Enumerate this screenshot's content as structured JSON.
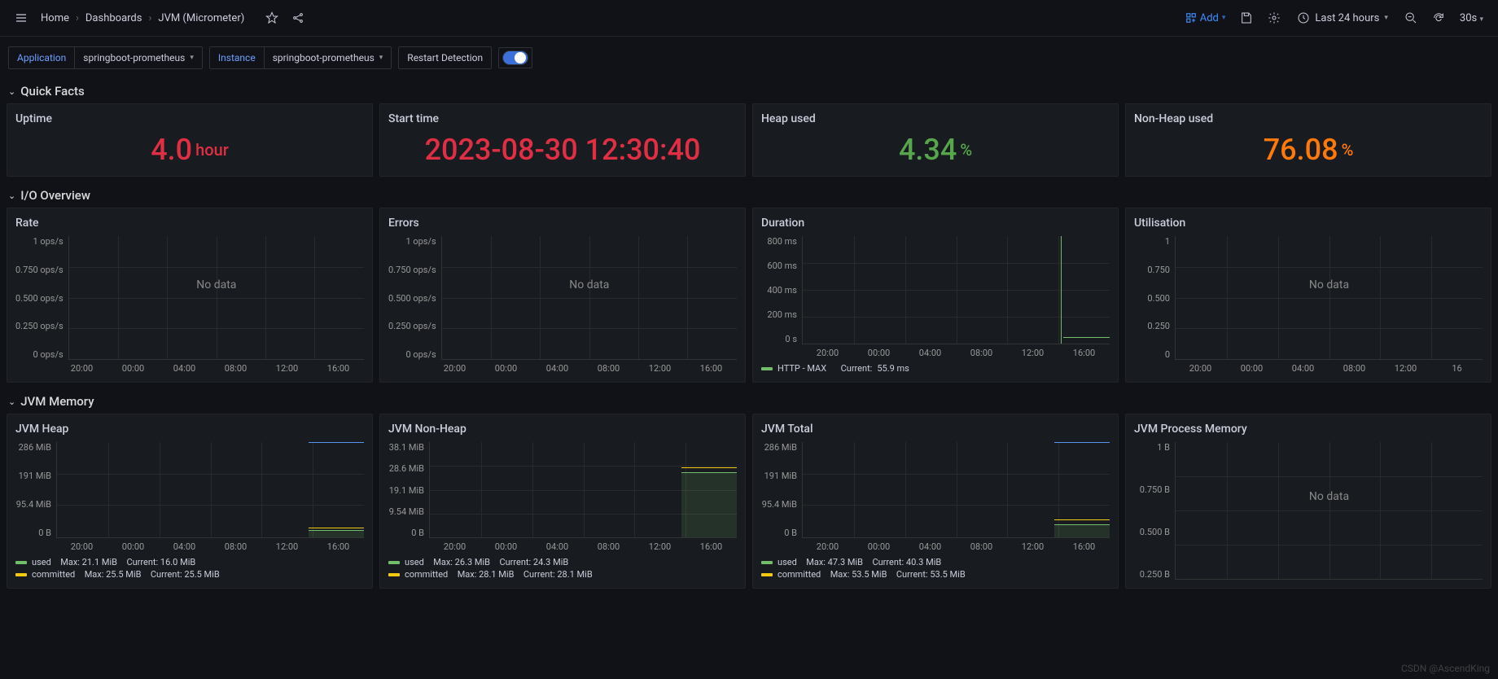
{
  "breadcrumb": {
    "home": "Home",
    "dashboards": "Dashboards",
    "current": "JVM (Micrometer)"
  },
  "header": {
    "add": "Add",
    "time_range": "Last 24 hours",
    "refresh_interval": "30s"
  },
  "vars": {
    "application_label": "Application",
    "application_value": "springboot-prometheus",
    "instance_label": "Instance",
    "instance_value": "springboot-prometheus",
    "restart_label": "Restart Detection"
  },
  "rows": {
    "quick_facts": "Quick Facts",
    "io_overview": "I/O Overview",
    "jvm_memory": "JVM Memory"
  },
  "stats": {
    "uptime": {
      "title": "Uptime",
      "value": "4.0",
      "unit": "hour"
    },
    "start_time": {
      "title": "Start time",
      "value": "2023-08-30 12:30:40"
    },
    "heap_used": {
      "title": "Heap used",
      "value": "4.34",
      "unit": "%"
    },
    "nonheap_used": {
      "title": "Non-Heap used",
      "value": "76.08",
      "unit": "%"
    }
  },
  "io": {
    "rate": {
      "title": "Rate",
      "y": [
        "1 ops/s",
        "0.750 ops/s",
        "0.500 ops/s",
        "0.250 ops/s",
        "0 ops/s"
      ],
      "nodata": "No data"
    },
    "errors": {
      "title": "Errors",
      "y": [
        "1 ops/s",
        "0.750 ops/s",
        "0.500 ops/s",
        "0.250 ops/s",
        "0 ops/s"
      ],
      "nodata": "No data"
    },
    "duration": {
      "title": "Duration",
      "y": [
        "800 ms",
        "600 ms",
        "400 ms",
        "200 ms",
        "0 s"
      ],
      "legend_series": "HTTP - MAX",
      "legend_current_label": "Current:",
      "legend_current_value": "55.9 ms"
    },
    "utilisation": {
      "title": "Utilisation",
      "y": [
        "1",
        "0.750",
        "0.500",
        "0.250",
        "0"
      ],
      "nodata": "No data"
    },
    "x_times": [
      "20:00",
      "00:00",
      "04:00",
      "08:00",
      "12:00",
      "16:00"
    ],
    "x_times_short": [
      "20:00",
      "00:00",
      "04:00",
      "08:00",
      "12:00",
      "16"
    ]
  },
  "mem": {
    "heap": {
      "title": "JVM Heap",
      "y": [
        "286 MiB",
        "191 MiB",
        "95.4 MiB",
        "0 B"
      ],
      "legend": [
        {
          "name": "used",
          "max": "Max: 21.1 MiB",
          "current": "Current: 16.0 MiB",
          "color": "sw-green"
        },
        {
          "name": "committed",
          "max": "Max: 25.5 MiB",
          "current": "Current: 25.5 MiB",
          "color": "sw-yellow"
        }
      ]
    },
    "nonheap": {
      "title": "JVM Non-Heap",
      "y": [
        "38.1 MiB",
        "28.6 MiB",
        "19.1 MiB",
        "9.54 MiB",
        "0 B"
      ],
      "legend": [
        {
          "name": "used",
          "max": "Max: 26.3 MiB",
          "current": "Current: 24.3 MiB",
          "color": "sw-green"
        },
        {
          "name": "committed",
          "max": "Max: 28.1 MiB",
          "current": "Current: 28.1 MiB",
          "color": "sw-yellow"
        }
      ]
    },
    "total": {
      "title": "JVM Total",
      "y": [
        "286 MiB",
        "191 MiB",
        "95.4 MiB",
        "0 B"
      ],
      "legend": [
        {
          "name": "used",
          "max": "Max: 47.3 MiB",
          "current": "Current: 40.3 MiB",
          "color": "sw-green"
        },
        {
          "name": "committed",
          "max": "Max: 53.5 MiB",
          "current": "Current: 53.5 MiB",
          "color": "sw-yellow"
        }
      ]
    },
    "process": {
      "title": "JVM Process Memory",
      "y": [
        "1 B",
        "0.750 B",
        "0.500 B",
        "0.250 B"
      ],
      "nodata": "No data"
    },
    "x_times": [
      "20:00",
      "00:00",
      "04:00",
      "08:00",
      "12:00",
      "16:00"
    ]
  },
  "watermark": "CSDN @AscendKing",
  "chart_data": [
    {
      "type": "stat",
      "title": "Uptime",
      "value": 4.0,
      "unit": "hour"
    },
    {
      "type": "stat",
      "title": "Start time",
      "value": "2023-08-30 12:30:40"
    },
    {
      "type": "stat",
      "title": "Heap used",
      "value": 4.34,
      "unit": "%"
    },
    {
      "type": "stat",
      "title": "Non-Heap used",
      "value": 76.08,
      "unit": "%"
    },
    {
      "type": "line",
      "title": "Rate",
      "ylabel": "ops/s",
      "ylim": [
        0,
        1
      ],
      "series": [],
      "x": [
        "20:00",
        "00:00",
        "04:00",
        "08:00",
        "12:00",
        "16:00"
      ]
    },
    {
      "type": "line",
      "title": "Errors",
      "ylabel": "ops/s",
      "ylim": [
        0,
        1
      ],
      "series": [],
      "x": [
        "20:00",
        "00:00",
        "04:00",
        "08:00",
        "12:00",
        "16:00"
      ]
    },
    {
      "type": "line",
      "title": "Duration",
      "ylabel": "ms",
      "ylim": [
        0,
        800
      ],
      "x": [
        "20:00",
        "00:00",
        "04:00",
        "08:00",
        "12:00",
        "16:00"
      ],
      "series": [
        {
          "name": "HTTP - MAX",
          "current": 55.9,
          "spike_at": "12:30",
          "spike_value": 800
        }
      ]
    },
    {
      "type": "line",
      "title": "Utilisation",
      "ylim": [
        0,
        1
      ],
      "series": [],
      "x": [
        "20:00",
        "00:00",
        "04:00",
        "08:00",
        "12:00",
        "16:00"
      ]
    },
    {
      "type": "area",
      "title": "JVM Heap",
      "ylabel": "MiB",
      "ylim": [
        0,
        286
      ],
      "x": [
        "20:00",
        "00:00",
        "04:00",
        "08:00",
        "12:00",
        "16:00"
      ],
      "series": [
        {
          "name": "used",
          "max": 21.1,
          "current": 16.0
        },
        {
          "name": "committed",
          "max": 25.5,
          "current": 25.5
        }
      ]
    },
    {
      "type": "area",
      "title": "JVM Non-Heap",
      "ylabel": "MiB",
      "ylim": [
        0,
        38.1
      ],
      "x": [
        "20:00",
        "00:00",
        "04:00",
        "08:00",
        "12:00",
        "16:00"
      ],
      "series": [
        {
          "name": "used",
          "max": 26.3,
          "current": 24.3
        },
        {
          "name": "committed",
          "max": 28.1,
          "current": 28.1
        }
      ]
    },
    {
      "type": "area",
      "title": "JVM Total",
      "ylabel": "MiB",
      "ylim": [
        0,
        286
      ],
      "x": [
        "20:00",
        "00:00",
        "04:00",
        "08:00",
        "12:00",
        "16:00"
      ],
      "series": [
        {
          "name": "used",
          "max": 47.3,
          "current": 40.3
        },
        {
          "name": "committed",
          "max": 53.5,
          "current": 53.5
        }
      ]
    },
    {
      "type": "line",
      "title": "JVM Process Memory",
      "ylabel": "B",
      "ylim": [
        0,
        1
      ],
      "series": [],
      "x": [
        "20:00",
        "00:00",
        "04:00",
        "08:00",
        "12:00",
        "16:00"
      ]
    }
  ]
}
